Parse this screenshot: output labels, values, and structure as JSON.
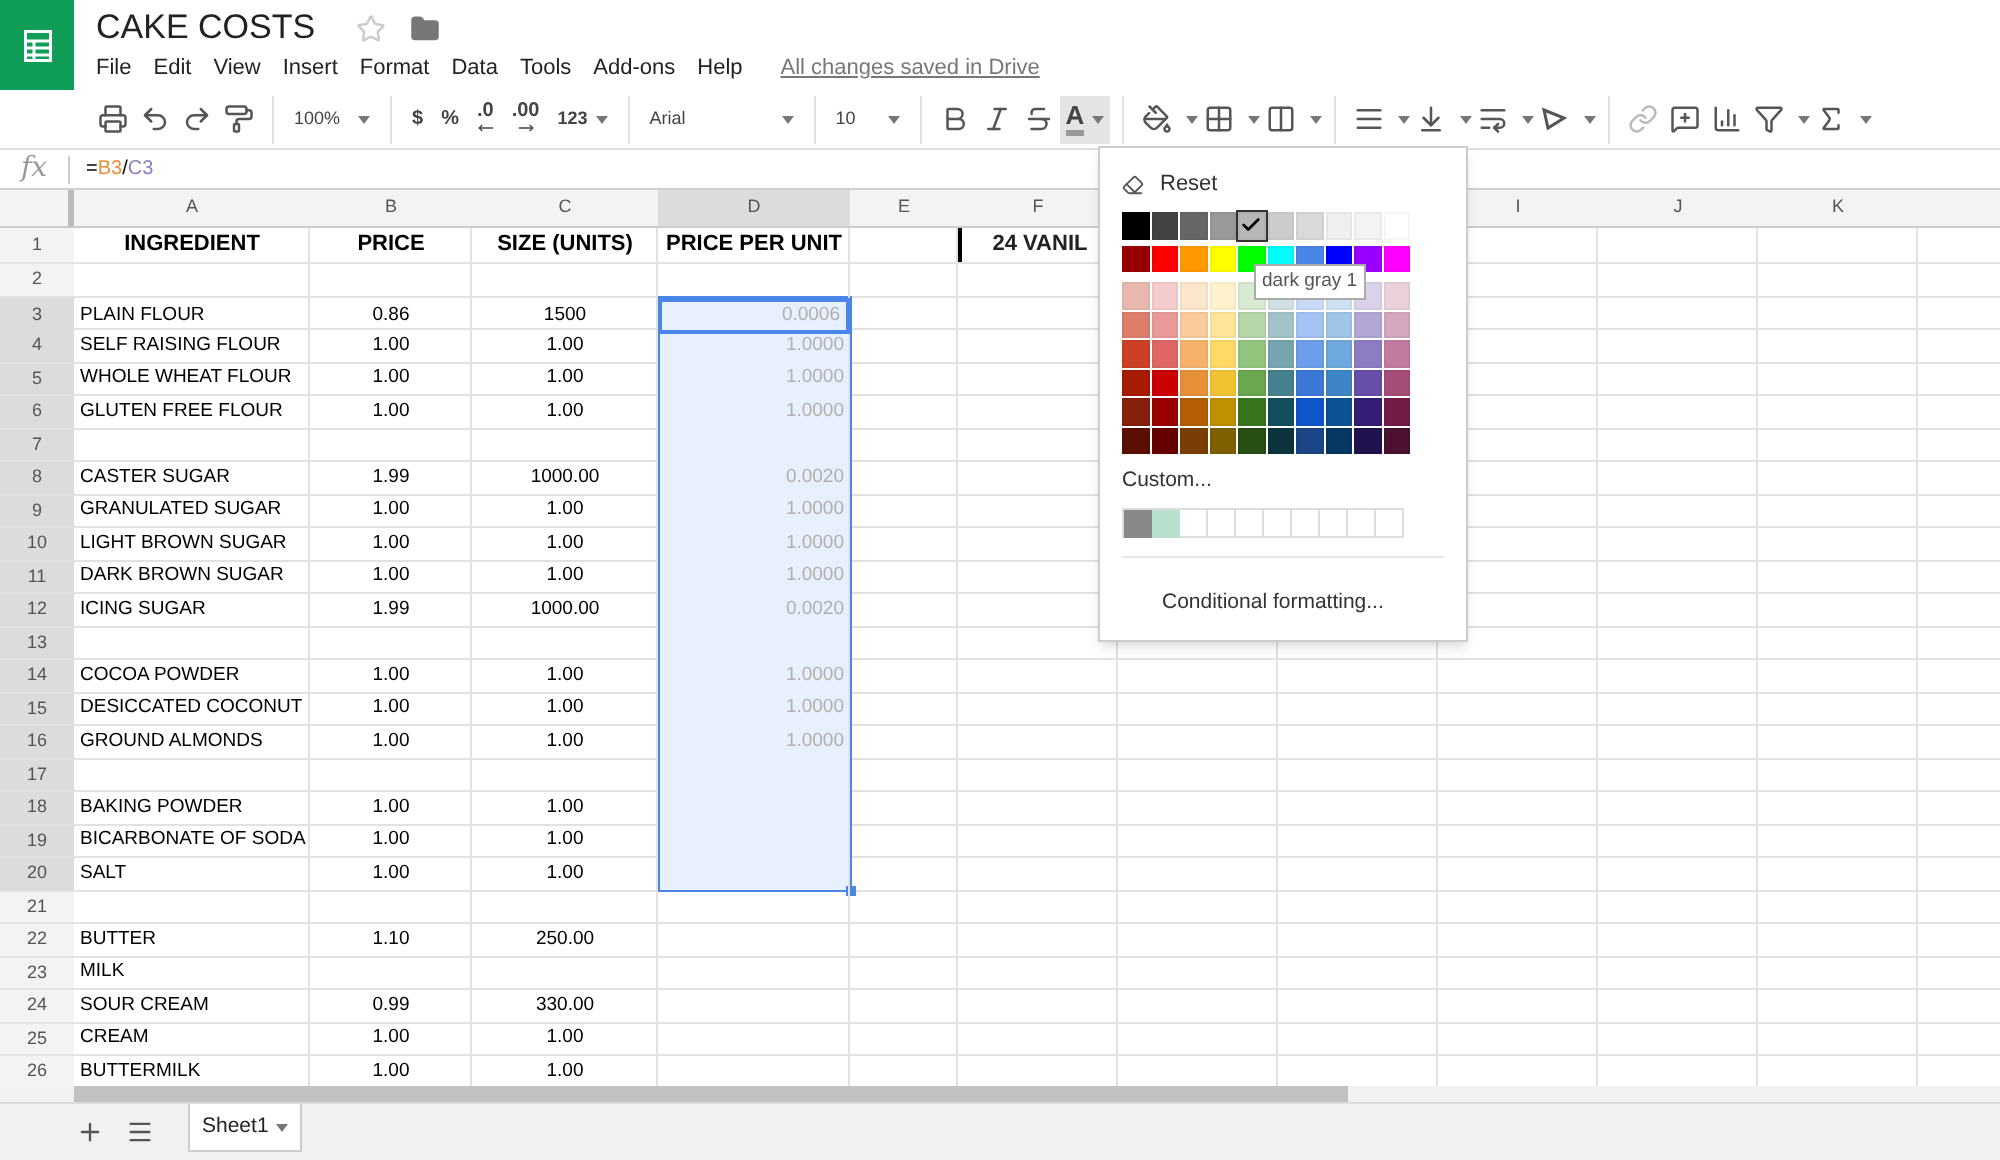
{
  "document": {
    "title": "CAKE COSTS",
    "save_status": "All changes saved in Drive"
  },
  "menu": [
    "File",
    "Edit",
    "View",
    "Insert",
    "Format",
    "Data",
    "Tools",
    "Add-ons",
    "Help"
  ],
  "toolbar": {
    "zoom": "100%",
    "currency": "$",
    "percent": "%",
    "decrease_decimals": ".0",
    "increase_decimals": ".00",
    "more_formats": "123",
    "font": "Arial",
    "font_size": "10",
    "text_color_label": "A",
    "text_color_pressed": true
  },
  "formula_bar": {
    "label": "fx",
    "tokens": [
      {
        "text": "=",
        "kind": "operator"
      },
      {
        "text": "B3",
        "kind": "reference",
        "color": "#e69138"
      },
      {
        "text": "/",
        "kind": "operator"
      },
      {
        "text": "C3",
        "kind": "reference",
        "color": "#8e7cc3"
      }
    ]
  },
  "columns": [
    {
      "label": "A",
      "selected": false
    },
    {
      "label": "B",
      "selected": false
    },
    {
      "label": "C",
      "selected": false
    },
    {
      "label": "D",
      "selected": true
    },
    {
      "label": "E",
      "selected": false
    },
    {
      "label": "F",
      "selected": false
    }
  ],
  "columns_right_of_menu": [
    {
      "label": "I",
      "selected": false
    },
    {
      "label": "J",
      "selected": false
    },
    {
      "label": "K",
      "selected": false
    }
  ],
  "rows": [
    {
      "number": "1",
      "kind": "heading",
      "selected": false,
      "active": false,
      "cells": {
        "a": "INGREDIENT",
        "b": "PRICE",
        "c": "SIZE (UNITS)",
        "d": "PRICE PER UNIT",
        "f": "24 VANIL"
      }
    },
    {
      "number": "2",
      "kind": "data",
      "selected": false,
      "active": false,
      "cells": {}
    },
    {
      "number": "3",
      "kind": "data",
      "selected": true,
      "active": true,
      "cells": {
        "a": "PLAIN FLOUR",
        "b": "0.86",
        "c": "1500",
        "d": "0.0006"
      }
    },
    {
      "number": "4",
      "kind": "data",
      "selected": true,
      "active": false,
      "cells": {
        "a": "SELF RAISING FLOUR",
        "b": "1.00",
        "c": "1.00",
        "d": "1.0000"
      }
    },
    {
      "number": "5",
      "kind": "data",
      "selected": true,
      "active": false,
      "cells": {
        "a": "WHOLE WHEAT FLOUR",
        "b": "1.00",
        "c": "1.00",
        "d": "1.0000"
      }
    },
    {
      "number": "6",
      "kind": "data",
      "selected": true,
      "active": false,
      "cells": {
        "a": "GLUTEN FREE FLOUR",
        "b": "1.00",
        "c": "1.00",
        "d": "1.0000"
      }
    },
    {
      "number": "7",
      "kind": "data",
      "selected": true,
      "active": false,
      "cells": {}
    },
    {
      "number": "8",
      "kind": "data",
      "selected": true,
      "active": false,
      "cells": {
        "a": "CASTER SUGAR",
        "b": "1.99",
        "c": "1000.00",
        "d": "0.0020"
      }
    },
    {
      "number": "9",
      "kind": "data",
      "selected": true,
      "active": false,
      "cells": {
        "a": "GRANULATED SUGAR",
        "b": "1.00",
        "c": "1.00",
        "d": "1.0000"
      }
    },
    {
      "number": "10",
      "kind": "data",
      "selected": true,
      "active": false,
      "cells": {
        "a": "LIGHT BROWN SUGAR",
        "b": "1.00",
        "c": "1.00",
        "d": "1.0000"
      }
    },
    {
      "number": "11",
      "kind": "data",
      "selected": true,
      "active": false,
      "cells": {
        "a": "DARK BROWN SUGAR",
        "b": "1.00",
        "c": "1.00",
        "d": "1.0000"
      }
    },
    {
      "number": "12",
      "kind": "data",
      "selected": true,
      "active": false,
      "cells": {
        "a": "ICING SUGAR",
        "b": "1.99",
        "c": "1000.00",
        "d": "0.0020"
      }
    },
    {
      "number": "13",
      "kind": "data",
      "selected": true,
      "active": false,
      "cells": {}
    },
    {
      "number": "14",
      "kind": "data",
      "selected": true,
      "active": false,
      "cells": {
        "a": "COCOA POWDER",
        "b": "1.00",
        "c": "1.00",
        "d": "1.0000"
      }
    },
    {
      "number": "15",
      "kind": "data",
      "selected": true,
      "active": false,
      "cells": {
        "a": "DESICCATED COCONUT",
        "b": "1.00",
        "c": "1.00",
        "d": "1.0000"
      }
    },
    {
      "number": "16",
      "kind": "data",
      "selected": true,
      "active": false,
      "cells": {
        "a": "GROUND ALMONDS",
        "b": "1.00",
        "c": "1.00",
        "d": "1.0000"
      }
    },
    {
      "number": "17",
      "kind": "data",
      "selected": true,
      "active": false,
      "cells": {}
    },
    {
      "number": "18",
      "kind": "data",
      "selected": true,
      "active": false,
      "cells": {
        "a": "BAKING POWDER",
        "b": "1.00",
        "c": "1.00"
      }
    },
    {
      "number": "19",
      "kind": "data",
      "selected": true,
      "active": false,
      "cells": {
        "a": "BICARBONATE OF SODA",
        "b": "1.00",
        "c": "1.00"
      }
    },
    {
      "number": "20",
      "kind": "data",
      "selected": true,
      "active": false,
      "cells": {
        "a": "SALT",
        "b": "1.00",
        "c": "1.00"
      }
    },
    {
      "number": "21",
      "kind": "data",
      "selected": false,
      "active": false,
      "cells": {}
    },
    {
      "number": "22",
      "kind": "data",
      "selected": false,
      "active": false,
      "cells": {
        "a": "BUTTER",
        "b": "1.10",
        "c": "250.00"
      }
    },
    {
      "number": "23",
      "kind": "data",
      "selected": false,
      "active": false,
      "cells": {
        "a": "MILK"
      }
    },
    {
      "number": "24",
      "kind": "data",
      "selected": false,
      "active": false,
      "cells": {
        "a": "SOUR CREAM",
        "b": "0.99",
        "c": "330.00"
      }
    },
    {
      "number": "25",
      "kind": "data",
      "selected": false,
      "active": false,
      "cells": {
        "a": "CREAM",
        "b": "1.00",
        "c": "1.00"
      }
    },
    {
      "number": "26",
      "kind": "data",
      "selected": false,
      "active": false,
      "cells": {
        "a": "BUTTERMILK",
        "b": "1.00",
        "c": "1.00"
      }
    }
  ],
  "color_menu": {
    "reset": "Reset",
    "tooltip": "dark gray 1",
    "custom": "Custom...",
    "conditional": "Conditional formatting...",
    "palette": [
      [
        {
          "color": "#000000",
          "selected": false
        },
        {
          "color": "#434343",
          "selected": false
        },
        {
          "color": "#666666",
          "selected": false
        },
        {
          "color": "#999999",
          "selected": false
        },
        {
          "color": "#b7b7b7",
          "selected": true
        },
        {
          "color": "#cccccc",
          "selected": false
        },
        {
          "color": "#d9d9d9",
          "selected": false
        },
        {
          "color": "#efefef",
          "selected": false
        },
        {
          "color": "#f3f3f3",
          "selected": false
        },
        {
          "color": "#ffffff",
          "selected": false
        }
      ],
      [
        {
          "color": "#980000",
          "selected": false
        },
        {
          "color": "#ff0000",
          "selected": false
        },
        {
          "color": "#ff9900",
          "selected": false
        },
        {
          "color": "#ffff00",
          "selected": false
        },
        {
          "color": "#00ff00",
          "selected": false
        },
        {
          "color": "#00ffff",
          "selected": false
        },
        {
          "color": "#4a86e8",
          "selected": false
        },
        {
          "color": "#0000ff",
          "selected": false
        },
        {
          "color": "#9900ff",
          "selected": false
        },
        {
          "color": "#ff00ff",
          "selected": false
        }
      ],
      [
        {
          "color": "#e6b8af",
          "selected": false
        },
        {
          "color": "#f4cccc",
          "selected": false
        },
        {
          "color": "#fce5cd",
          "selected": false
        },
        {
          "color": "#fff2cc",
          "selected": false
        },
        {
          "color": "#d9ead3",
          "selected": false
        },
        {
          "color": "#d0e0e3",
          "selected": false
        },
        {
          "color": "#c9daf8",
          "selected": false
        },
        {
          "color": "#cfe2f3",
          "selected": false
        },
        {
          "color": "#d9d2e9",
          "selected": false
        },
        {
          "color": "#ead1dc",
          "selected": false
        }
      ],
      [
        {
          "color": "#dd7e6b",
          "selected": false
        },
        {
          "color": "#ea9999",
          "selected": false
        },
        {
          "color": "#f9cb9c",
          "selected": false
        },
        {
          "color": "#ffe599",
          "selected": false
        },
        {
          "color": "#b6d7a8",
          "selected": false
        },
        {
          "color": "#a2c4c9",
          "selected": false
        },
        {
          "color": "#a4c2f4",
          "selected": false
        },
        {
          "color": "#9fc5e8",
          "selected": false
        },
        {
          "color": "#b4a7d6",
          "selected": false
        },
        {
          "color": "#d5a6bd",
          "selected": false
        }
      ],
      [
        {
          "color": "#cc4125",
          "selected": false
        },
        {
          "color": "#e06666",
          "selected": false
        },
        {
          "color": "#f6b26b",
          "selected": false
        },
        {
          "color": "#ffd966",
          "selected": false
        },
        {
          "color": "#93c47d",
          "selected": false
        },
        {
          "color": "#76a5af",
          "selected": false
        },
        {
          "color": "#6d9eeb",
          "selected": false
        },
        {
          "color": "#6fa8dc",
          "selected": false
        },
        {
          "color": "#8e7cc3",
          "selected": false
        },
        {
          "color": "#c27ba0",
          "selected": false
        }
      ],
      [
        {
          "color": "#a61c00",
          "selected": false
        },
        {
          "color": "#cc0000",
          "selected": false
        },
        {
          "color": "#e69138",
          "selected": false
        },
        {
          "color": "#f1c232",
          "selected": false
        },
        {
          "color": "#6aa84f",
          "selected": false
        },
        {
          "color": "#45818e",
          "selected": false
        },
        {
          "color": "#3c78d8",
          "selected": false
        },
        {
          "color": "#3d85c6",
          "selected": false
        },
        {
          "color": "#674ea7",
          "selected": false
        },
        {
          "color": "#a64d79",
          "selected": false
        }
      ],
      [
        {
          "color": "#85200c",
          "selected": false
        },
        {
          "color": "#990000",
          "selected": false
        },
        {
          "color": "#b45f06",
          "selected": false
        },
        {
          "color": "#bf9000",
          "selected": false
        },
        {
          "color": "#38761d",
          "selected": false
        },
        {
          "color": "#134f5c",
          "selected": false
        },
        {
          "color": "#1155cc",
          "selected": false
        },
        {
          "color": "#0b5394",
          "selected": false
        },
        {
          "color": "#351c75",
          "selected": false
        },
        {
          "color": "#741b47",
          "selected": false
        }
      ],
      [
        {
          "color": "#5b0f00",
          "selected": false
        },
        {
          "color": "#660000",
          "selected": false
        },
        {
          "color": "#783f04",
          "selected": false
        },
        {
          "color": "#7f6000",
          "selected": false
        },
        {
          "color": "#274e13",
          "selected": false
        },
        {
          "color": "#0c343d",
          "selected": false
        },
        {
          "color": "#1c4587",
          "selected": false
        },
        {
          "color": "#073763",
          "selected": false
        },
        {
          "color": "#20124d",
          "selected": false
        },
        {
          "color": "#4c1130",
          "selected": false
        }
      ]
    ],
    "custom_colors": [
      {
        "color": "#888888"
      },
      {
        "color": "#b7e1cd"
      }
    ]
  },
  "sheets": [
    {
      "label": "Sheet1",
      "selected": true
    }
  ]
}
